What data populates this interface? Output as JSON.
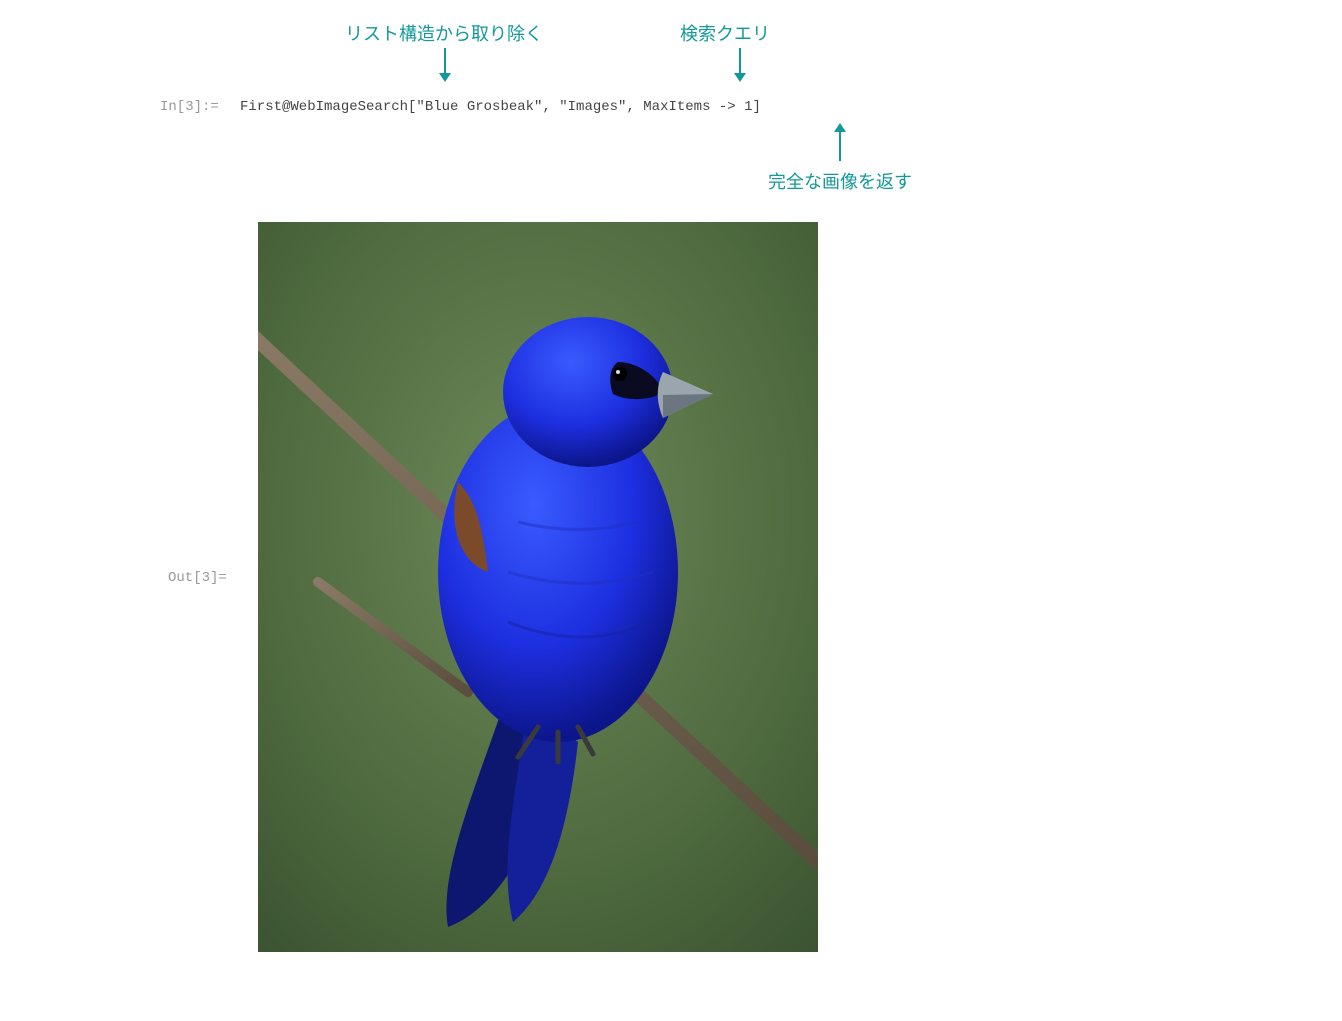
{
  "annotations": {
    "top_left": "リスト構造から取り除く",
    "top_right": "検索クエリ",
    "bottom": "完全な画像を返す"
  },
  "io": {
    "in_label": "In[3]:=",
    "out_label": "Out[3]=",
    "code": "First@WebImageSearch[\"Blue Grosbeak\", \"Images\", MaxItems -> 1]"
  },
  "colors": {
    "annot": "#139999",
    "io_label": "#9a9a9a"
  },
  "output": {
    "alt": "blue-grosbeak-photo"
  }
}
